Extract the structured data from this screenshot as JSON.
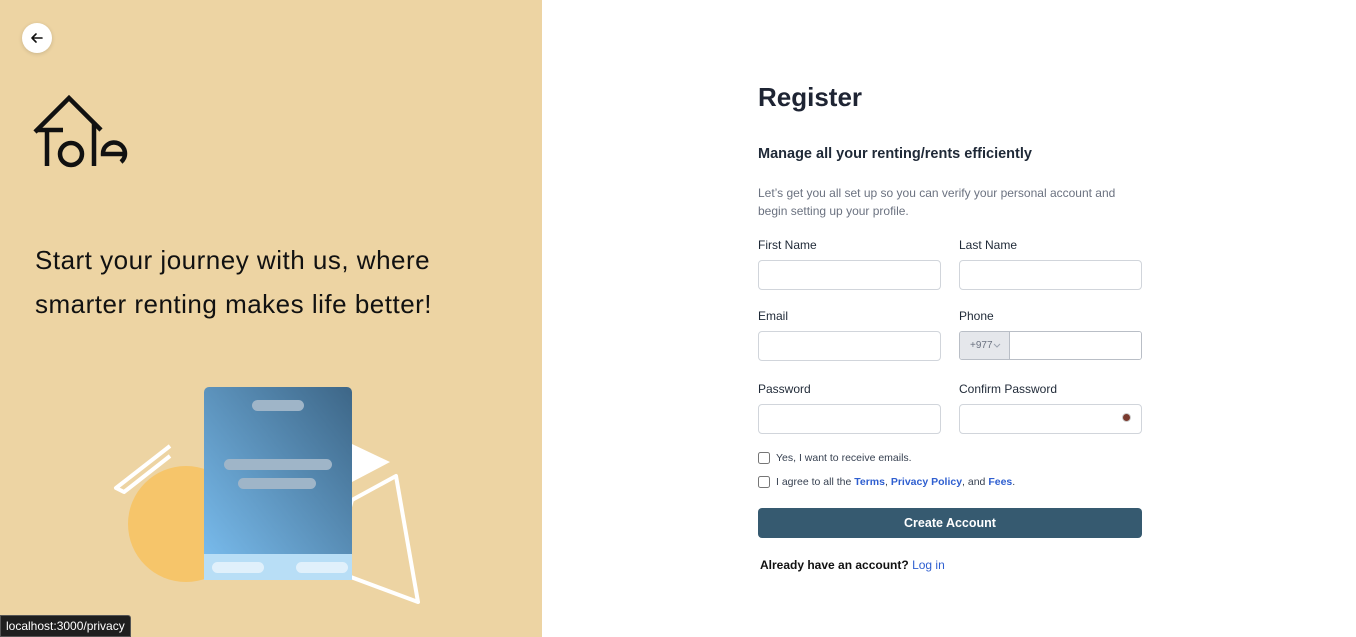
{
  "left": {
    "logo_text": "Tole",
    "tagline": "Start your journey with us, where smarter renting makes life better!",
    "background_color": "#edd4a3"
  },
  "form": {
    "title": "Register",
    "subtitle": "Manage all your renting/rents efficiently",
    "intro": "Let’s get you all set up so you can verify your personal account and begin setting up your profile.",
    "first_name": {
      "label": "First Name",
      "value": ""
    },
    "last_name": {
      "label": "Last Name",
      "value": ""
    },
    "email": {
      "label": "Email",
      "value": ""
    },
    "phone": {
      "label": "Phone",
      "country_code": "+977",
      "value": ""
    },
    "password": {
      "label": "Password",
      "value": ""
    },
    "confirm_password": {
      "label": "Confirm Password",
      "value": ""
    },
    "checkbox_emails": {
      "label": "Yes, I want to receive emails.",
      "checked": false
    },
    "checkbox_terms": {
      "prefix": "I agree to all the",
      "terms": "Terms",
      "comma": ",",
      "privacy": "Privacy Policy",
      "and": ", and",
      "fees": "Fees",
      "end": ".",
      "checked": false
    },
    "submit_label": "Create Account",
    "login_prompt": "Already have an account?",
    "login_link": "Log in",
    "accent_color": "#365a70",
    "link_color": "#2f5fd0"
  },
  "status_bar": {
    "url": "localhost:3000/privacy"
  }
}
